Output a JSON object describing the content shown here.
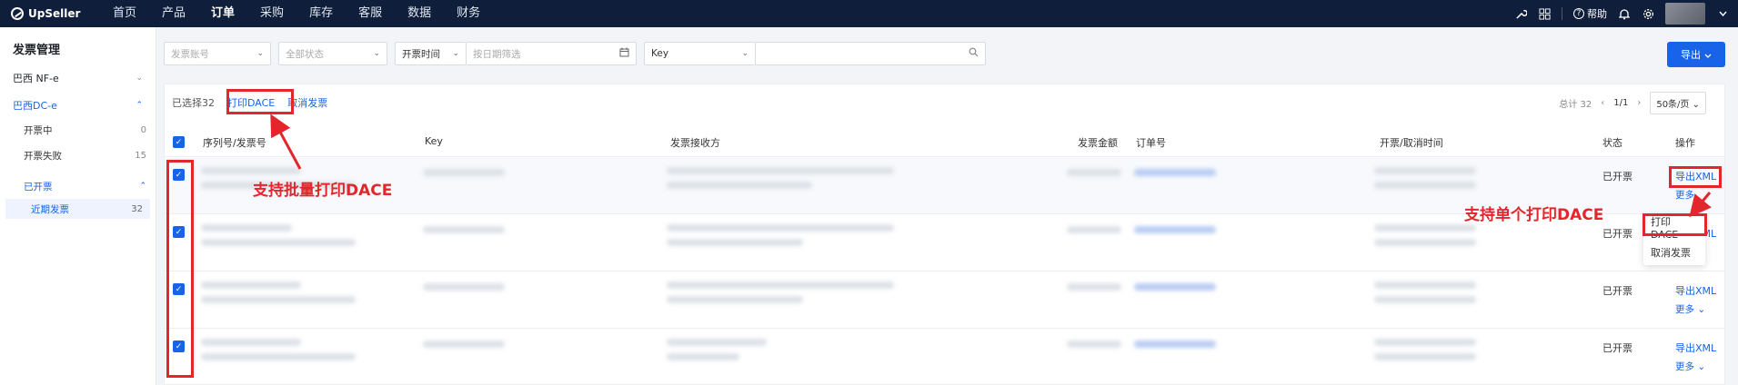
{
  "brand": "UpSeller",
  "nav": [
    "首页",
    "产品",
    "订单",
    "采购",
    "库存",
    "客服",
    "数据",
    "财务"
  ],
  "nav_active_index": 2,
  "top_right": {
    "help_label": "帮助"
  },
  "sidebar": {
    "title": "发票管理",
    "group_nfe": "巴西 NF-e",
    "group_dce": "巴西DC-e",
    "items": [
      {
        "label": "开票中",
        "count": "0"
      },
      {
        "label": "开票失败",
        "count": "15"
      }
    ],
    "issued_label": "已开票",
    "recent_label": "近期发票",
    "recent_count": "32"
  },
  "filters": {
    "account_placeholder": "发票账号",
    "status_placeholder": "全部状态",
    "time_label": "开票时间",
    "date_placeholder": "按日期筛选",
    "key_label": "Key",
    "search_value": ""
  },
  "export_button": "导出",
  "toolbar": {
    "selected_label": "已选择",
    "selected_count": "32",
    "print_dace": "打印DACE",
    "cancel_invoice": "取消发票"
  },
  "pager": {
    "total": "总计 32",
    "page": "1/1",
    "page_size": "50条/页"
  },
  "columns": [
    "序列号/发票号",
    "Key",
    "发票接收方",
    "发票金额",
    "订单号",
    "开票/取消时间",
    "状态",
    "操作"
  ],
  "rows": [
    {
      "status": "已开票",
      "op": "导出XML",
      "more": "更多"
    },
    {
      "status": "已开票",
      "op": "导出XML",
      "more": ""
    },
    {
      "status": "已开票",
      "op": "导出XML",
      "more": "更多"
    },
    {
      "status": "已开票",
      "op": "导出XML",
      "more": "更多"
    }
  ],
  "dropdown": {
    "print_dace": "打印DACE",
    "cancel_invoice": "取消发票"
  },
  "annotations": {
    "batch_print": "支持批量打印DACE",
    "single_print": "支持单个打印DACE"
  },
  "colors": {
    "accent": "#1863e8",
    "topbar": "#0f1e3a",
    "annotation": "#e3262b"
  }
}
